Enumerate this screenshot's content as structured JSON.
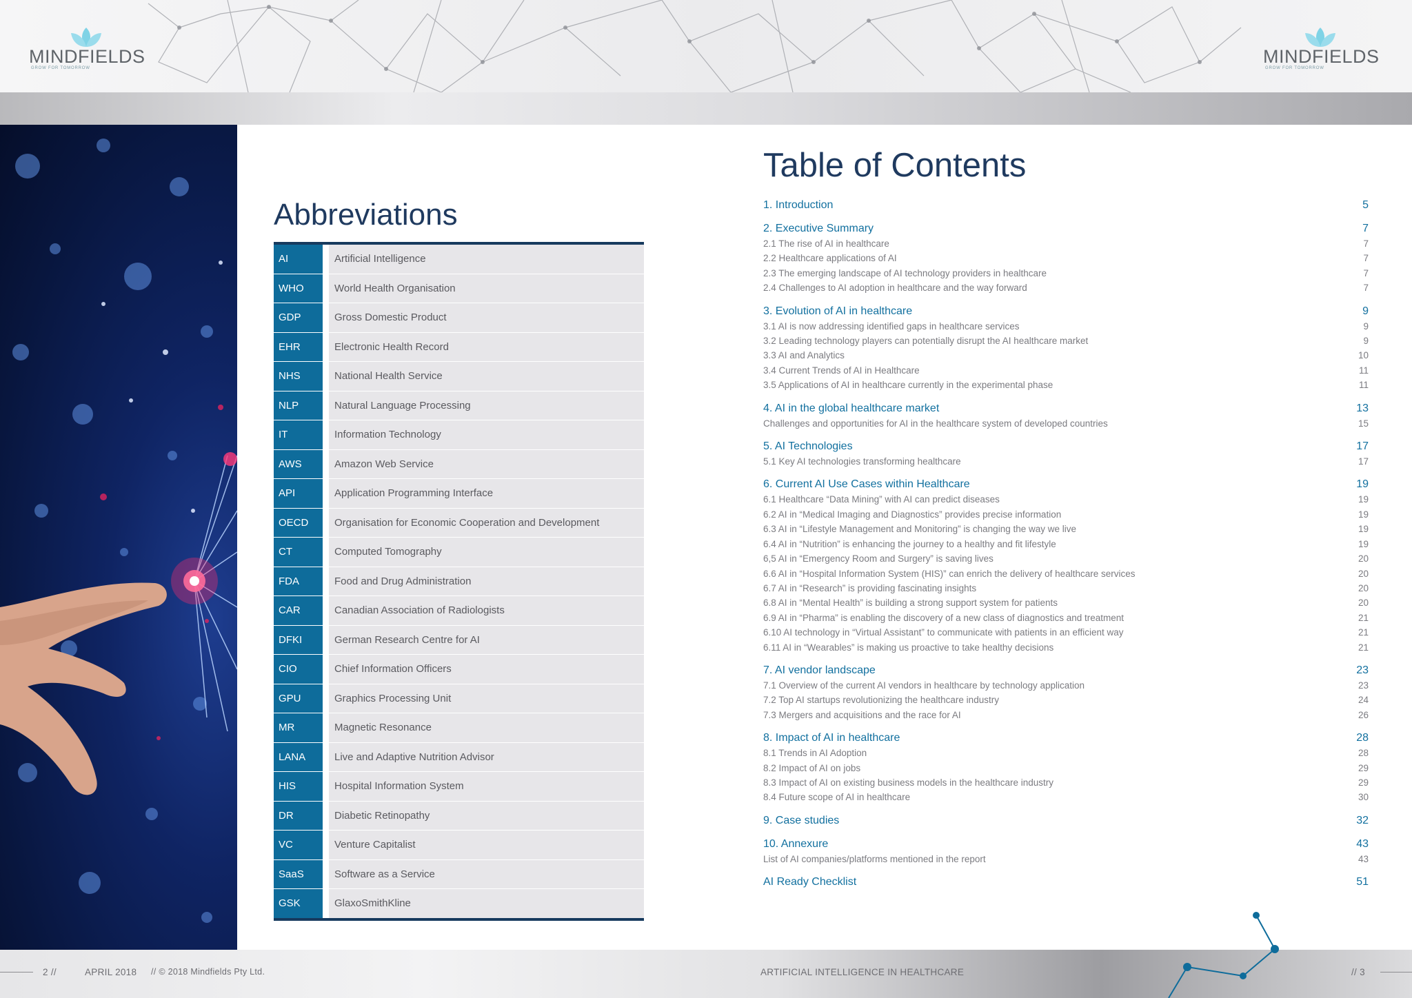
{
  "header": {
    "brand": "MINDFIELDS",
    "tagline": "GROW FOR TOMORROW",
    "brand_color": "#7fd3e6"
  },
  "abbreviations": {
    "title": "Abbreviations",
    "items": [
      {
        "code": "AI",
        "meaning": "Artificial Intelligence"
      },
      {
        "code": "WHO",
        "meaning": "World Health Organisation"
      },
      {
        "code": "GDP",
        "meaning": "Gross Domestic Product"
      },
      {
        "code": "EHR",
        "meaning": "Electronic Health Record"
      },
      {
        "code": "NHS",
        "meaning": "National Health Service"
      },
      {
        "code": "NLP",
        "meaning": "Natural Language Processing"
      },
      {
        "code": "IT",
        "meaning": "Information Technology"
      },
      {
        "code": "AWS",
        "meaning": "Amazon Web Service"
      },
      {
        "code": "API",
        "meaning": "Application Programming Interface"
      },
      {
        "code": "OECD",
        "meaning": "Organisation for Economic Cooperation and Development"
      },
      {
        "code": "CT",
        "meaning": "Computed Tomography"
      },
      {
        "code": "FDA",
        "meaning": "Food and Drug Administration"
      },
      {
        "code": "CAR",
        "meaning": "Canadian Association of Radiologists"
      },
      {
        "code": "DFKI",
        "meaning": "German Research Centre for AI"
      },
      {
        "code": "CIO",
        "meaning": "Chief Information Officers"
      },
      {
        "code": "GPU",
        "meaning": "Graphics Processing Unit"
      },
      {
        "code": "MR",
        "meaning": "Magnetic Resonance"
      },
      {
        "code": "LANA",
        "meaning": "Live and Adaptive Nutrition Advisor"
      },
      {
        "code": "HIS",
        "meaning": "Hospital Information System"
      },
      {
        "code": "DR",
        "meaning": "Diabetic Retinopathy"
      },
      {
        "code": "VC",
        "meaning": "Venture Capitalist"
      },
      {
        "code": "SaaS",
        "meaning": "Software as a Service"
      },
      {
        "code": "GSK",
        "meaning": "GlaxoSmithKline"
      }
    ]
  },
  "toc": {
    "title": "Table of Contents",
    "sections": [
      {
        "title": "1. Introduction",
        "page": "5",
        "subs": []
      },
      {
        "title": "2. Executive Summary",
        "page": "7",
        "subs": [
          {
            "title": "2.1 The rise of AI in healthcare",
            "page": "7"
          },
          {
            "title": "2.2 Healthcare applications of AI",
            "page": "7"
          },
          {
            "title": "2.3 The emerging landscape of AI technology providers in healthcare",
            "page": "7"
          },
          {
            "title": "2.4 Challenges to AI adoption in healthcare and the way forward",
            "page": "7"
          }
        ]
      },
      {
        "title": "3. Evolution of AI in healthcare",
        "page": "9",
        "subs": [
          {
            "title": "3.1 AI is now addressing identified gaps in healthcare services",
            "page": "9"
          },
          {
            "title": "3.2 Leading technology players can potentially disrupt the AI healthcare market",
            "page": "9"
          },
          {
            "title": "3.3 AI and Analytics",
            "page": "10"
          },
          {
            "title": "3.4 Current Trends of AI in Healthcare",
            "page": "11"
          },
          {
            "title": "3.5 Applications of AI in healthcare currently in the experimental phase",
            "page": "11"
          }
        ]
      },
      {
        "title": "4. AI in the global healthcare market",
        "page": "13",
        "subs": [
          {
            "title": "Challenges and opportunities for AI in the healthcare system of developed countries",
            "page": "15"
          }
        ]
      },
      {
        "title": "5. AI Technologies",
        "page": "17",
        "subs": [
          {
            "title": "5.1 Key AI technologies transforming healthcare",
            "page": "17"
          }
        ]
      },
      {
        "title": "6. Current AI Use Cases within Healthcare",
        "page": "19",
        "subs": [
          {
            "title": "6.1 Healthcare “Data Mining” with AI can predict diseases",
            "page": "19"
          },
          {
            "title": "6.2 AI in “Medical Imaging and Diagnostics” provides precise information",
            "page": "19"
          },
          {
            "title": "6.3 AI in “Lifestyle Management and Monitoring” is changing the way we live",
            "page": "19"
          },
          {
            "title": "6.4 AI in “Nutrition” is enhancing the journey to a healthy and fit lifestyle",
            "page": "19"
          },
          {
            "title": "6,5 AI in “Emergency Room and Surgery” is saving lives",
            "page": "20"
          },
          {
            "title": "6.6 AI in “Hospital Information System (HIS)” can enrich the delivery of healthcare services",
            "page": "20"
          },
          {
            "title": "6.7 AI in “Research” is providing fascinating insights",
            "page": "20"
          },
          {
            "title": "6.8 AI in “Mental Health” is building a strong support system for patients",
            "page": "20"
          },
          {
            "title": "6.9 AI in “Pharma” is enabling the discovery of a new class of diagnostics and treatment",
            "page": "21"
          },
          {
            "title": "6.10 AI technology in “Virtual Assistant” to communicate with patients in an efficient way",
            "page": "21"
          },
          {
            "title": "6.11 AI in “Wearables” is making us proactive to take healthy decisions",
            "page": "21"
          }
        ]
      },
      {
        "title": "7. AI vendor landscape",
        "page": "23",
        "subs": [
          {
            "title": "7.1 Overview of the current AI vendors in healthcare by technology application",
            "page": "23"
          },
          {
            "title": "7.2 Top AI startups revolutionizing the healthcare industry",
            "page": "24"
          },
          {
            "title": "7.3 Mergers and acquisitions and the race for AI",
            "page": "26"
          }
        ]
      },
      {
        "title": "8. Impact of AI in healthcare",
        "page": "28",
        "subs": [
          {
            "title": "8.1 Trends in AI Adoption",
            "page": "28"
          },
          {
            "title": "8.2 Impact of AI on jobs",
            "page": "29"
          },
          {
            "title": "8.3 Impact of AI on existing business models in the healthcare industry",
            "page": "29"
          },
          {
            "title": "8.4 Future scope of AI in healthcare",
            "page": "30"
          }
        ]
      },
      {
        "title": "9. Case studies",
        "page": "32",
        "subs": []
      },
      {
        "title": "10. Annexure",
        "page": "43",
        "subs": [
          {
            "title": "List of AI companies/platforms mentioned in the report",
            "page": "43"
          }
        ]
      },
      {
        "title": "AI Ready Checklist",
        "page": "51",
        "subs": []
      }
    ]
  },
  "footer": {
    "left_page": "2 //",
    "date": "APRIL 2018",
    "copyright": "// © 2018 Mindfields Pty Ltd.",
    "report_title": "ARTIFICIAL INTELLIGENCE IN HEALTHCARE",
    "right_page": "// 3"
  }
}
